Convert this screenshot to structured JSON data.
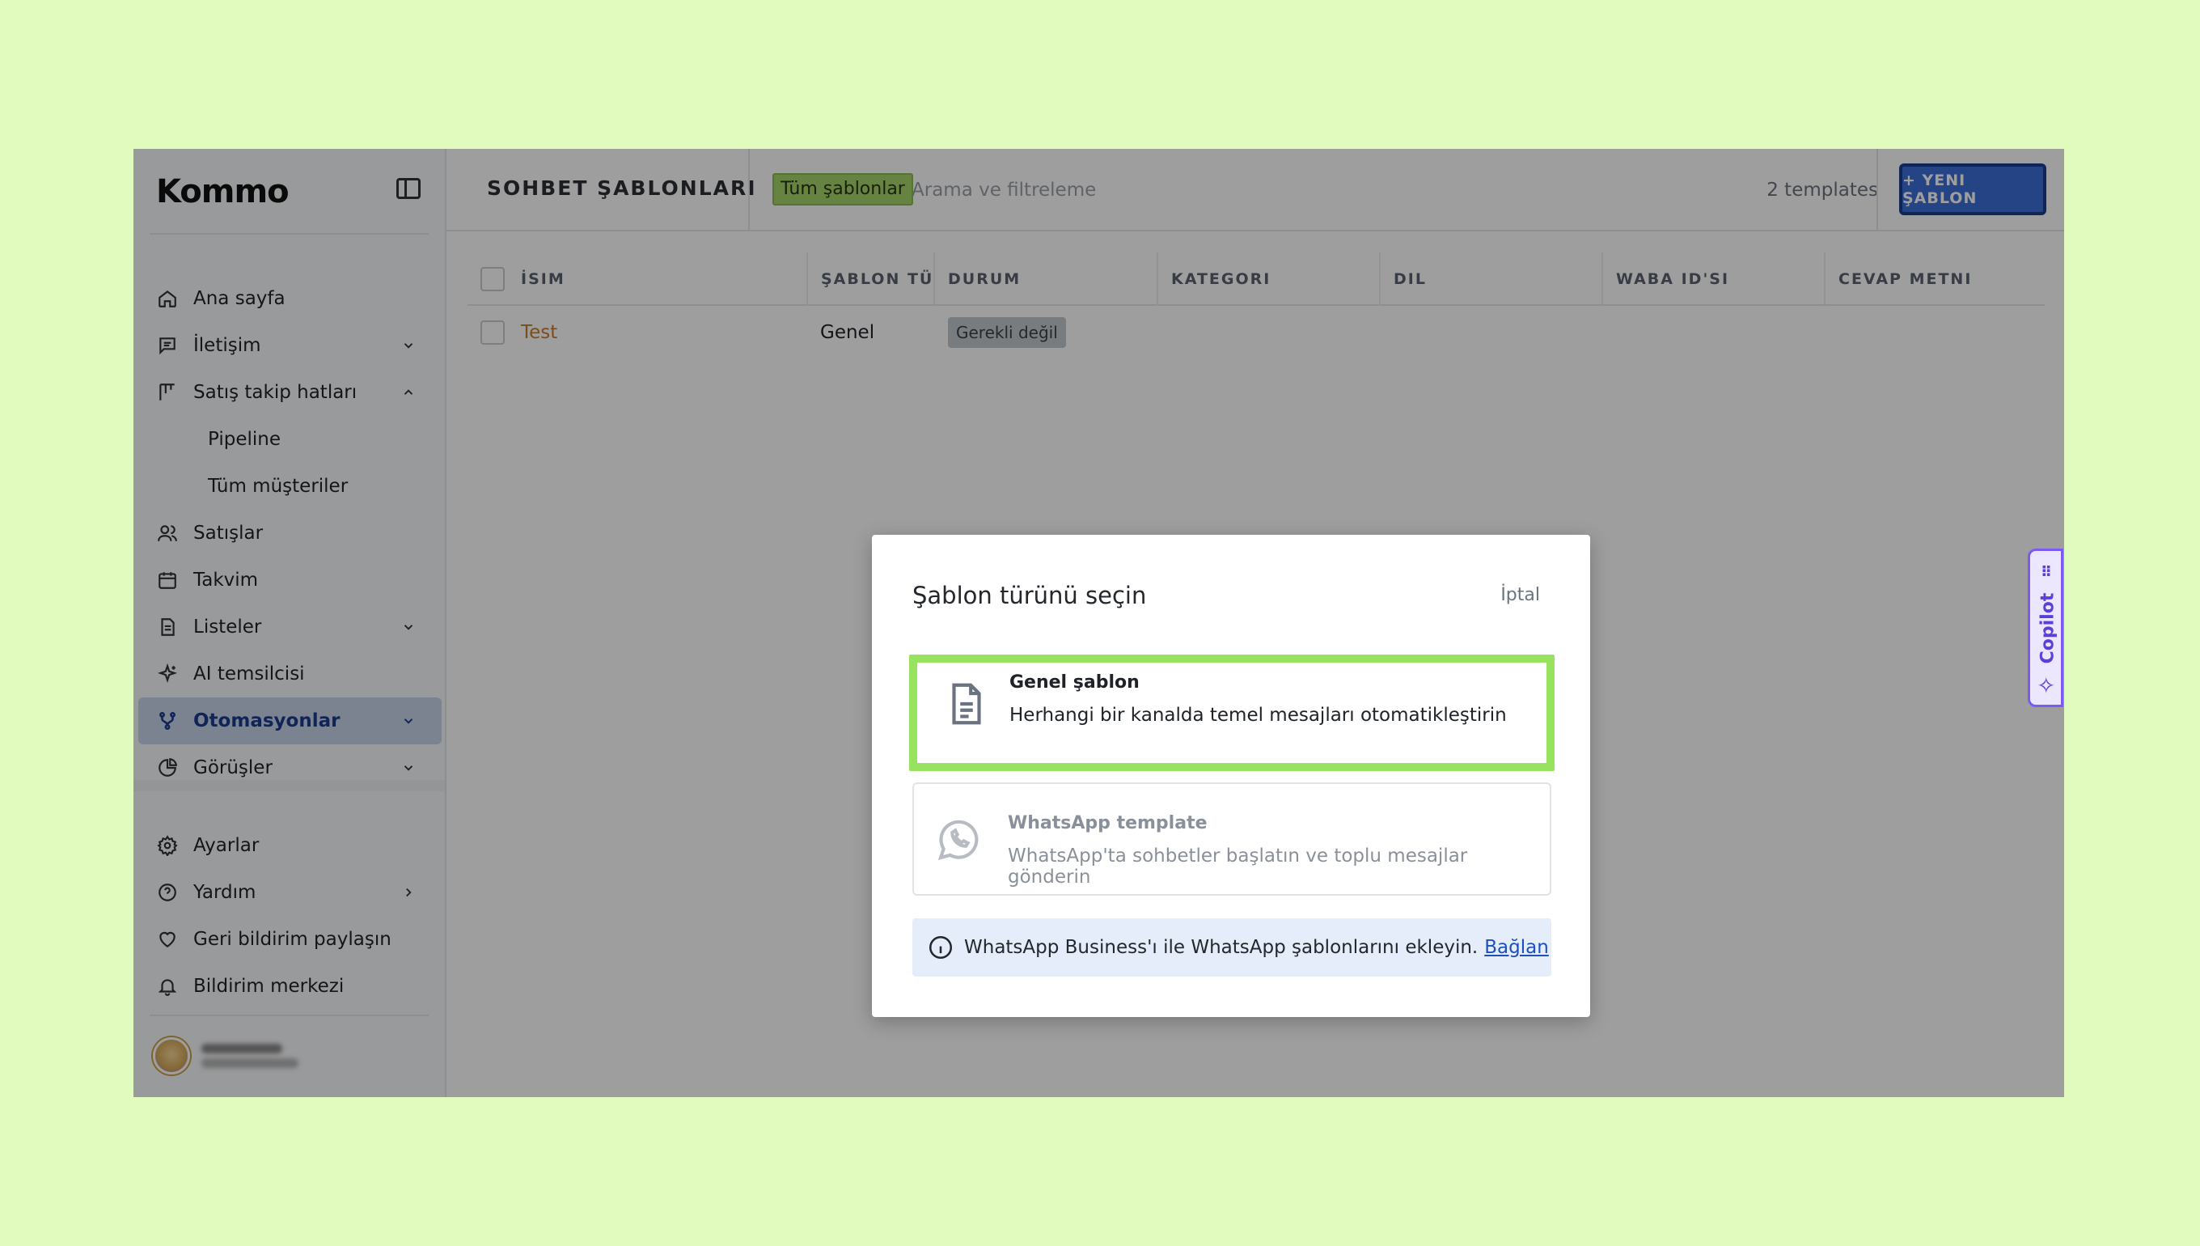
{
  "app": {
    "logo": "Kommo"
  },
  "sidebar": {
    "items": [
      {
        "label": "Ana sayfa",
        "icon": "home-icon"
      },
      {
        "label": "İletişim",
        "icon": "message-icon"
      },
      {
        "label": "Satış takip hatları",
        "icon": "kanban-icon"
      },
      {
        "label": "Pipeline"
      },
      {
        "label": "Tüm müşteriler"
      },
      {
        "label": "Satışlar",
        "icon": "users-icon"
      },
      {
        "label": "Takvim",
        "icon": "calendar-icon"
      },
      {
        "label": "Listeler",
        "icon": "document-icon"
      },
      {
        "label": "AI temsilcisi",
        "icon": "sparkles-icon"
      },
      {
        "label": "Otomasyonlar",
        "icon": "branch-icon"
      },
      {
        "label": "Görüşler",
        "icon": "pie-chart-icon"
      }
    ],
    "bottom": [
      {
        "label": "Ayarlar",
        "icon": "gear-icon"
      },
      {
        "label": "Yardım",
        "icon": "help-icon"
      },
      {
        "label": "Geri bildirim paylaşın",
        "icon": "heart-icon"
      },
      {
        "label": "Bildirim merkezi",
        "icon": "bell-icon"
      }
    ]
  },
  "header": {
    "title": "SOHBET ŞABLONLARI",
    "filter_tag": "Tüm şablonlar",
    "search_placeholder": "Arama ve filtreleme",
    "count": "2 templates",
    "new_button": "+ YENI ŞABLON"
  },
  "table": {
    "columns": [
      "İSIM",
      "ŞABLON TÜRÜ",
      "DURUM",
      "KATEGORI",
      "DIL",
      "WABA ID'SI",
      "CEVAP METNI"
    ],
    "rows": [
      {
        "name": "Test",
        "type": "Genel",
        "status": "Gerekli değil"
      }
    ]
  },
  "copilot": {
    "label": "Copilot"
  },
  "modal": {
    "title": "Şablon türünü seçin",
    "cancel": "İptal",
    "options": [
      {
        "title": "Genel şablon",
        "desc": "Herhangi bir kanalda temel mesajları otomatikleştirin",
        "icon": "document-icon"
      },
      {
        "title": "WhatsApp template",
        "desc": "WhatsApp'ta sohbetler başlatın ve toplu mesajlar gönderin",
        "icon": "whatsapp-icon"
      }
    ],
    "info_text": "WhatsApp Business'ı ile WhatsApp şablonlarını ekleyin.",
    "info_link": "Bağlan"
  },
  "colors": {
    "background": "#e0fbbd",
    "accent": "#3d6ed8",
    "highlight": "#97e35f",
    "active_nav": "#c8d4e8"
  }
}
